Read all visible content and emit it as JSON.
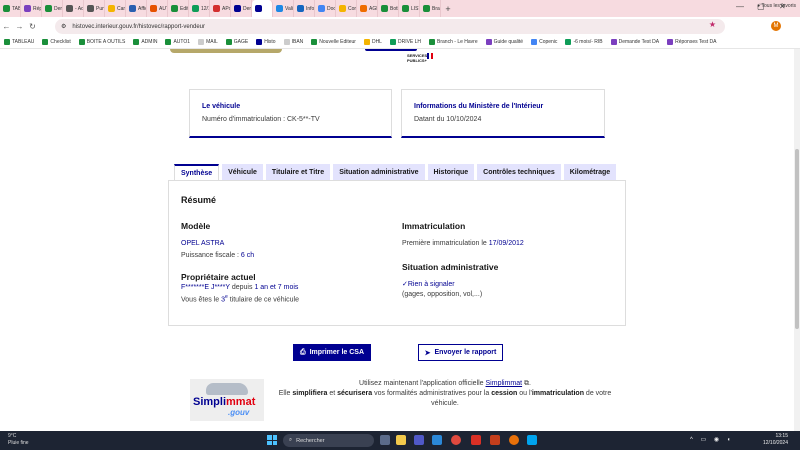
{
  "browser": {
    "tabs": [
      {
        "label": "TABL",
        "color": "#1a8f3a"
      },
      {
        "label": "Répc",
        "color": "#7b3fbf"
      },
      {
        "label": "Dem",
        "color": "#1a8f3a"
      },
      {
        "label": "- Ad",
        "color": "#555555"
      },
      {
        "label": "Puni",
        "color": "#555555"
      },
      {
        "label": "Car",
        "color": "#f4b400"
      },
      {
        "label": "Affic",
        "color": "#2a5fb0"
      },
      {
        "label": "AUT",
        "color": "#e65100"
      },
      {
        "label": "Editi",
        "color": "#1a8f3a"
      },
      {
        "label": "12/1",
        "color": "#0f9d58"
      },
      {
        "label": "APo",
        "color": "#d32f2f"
      },
      {
        "label": "Dem",
        "color": "#000091"
      },
      {
        "label": "",
        "color": "#000091",
        "active": true
      },
      {
        "label": "Vali",
        "color": "#1e88e5"
      },
      {
        "label": "Info",
        "color": "#1565c0"
      },
      {
        "label": "Doc",
        "color": "#4285f4"
      },
      {
        "label": "Con",
        "color": "#f4b400"
      },
      {
        "label": "AGE",
        "color": "#ef6c00"
      },
      {
        "label": "Both",
        "color": "#1a8f3a"
      },
      {
        "label": "LIST",
        "color": "#1a8f3a"
      },
      {
        "label": "Bran",
        "color": "#1a8f3a"
      }
    ],
    "url": "histovec.interieur.gouv.fr/histovec/rapport-vendeur",
    "profile_initial": "M",
    "bookmarks": [
      {
        "label": "TABLEAU",
        "color": "#1a8f3a"
      },
      {
        "label": "Checklist",
        "color": "#1a8f3a"
      },
      {
        "label": "BOITE A OUTILS",
        "color": "#1a8f3a"
      },
      {
        "label": "ADMIN",
        "color": "#1a8f3a"
      },
      {
        "label": "AUTO1",
        "color": "#1a8f3a"
      },
      {
        "label": "MAIL",
        "color": "#cccccc"
      },
      {
        "label": "GAGE",
        "color": "#1a8f3a"
      },
      {
        "label": "Histo",
        "color": "#000091"
      },
      {
        "label": "IBAN",
        "color": "#cccccc"
      },
      {
        "label": "Nouvelle Editeur",
        "color": "#1a8f3a"
      },
      {
        "label": "DHL",
        "color": "#f4b400"
      },
      {
        "label": "DRIVE LH",
        "color": "#0f9d58"
      },
      {
        "label": "Branch - Le Havre",
        "color": "#1a8f3a"
      },
      {
        "label": "Guide qualité",
        "color": "#7b3fbf"
      },
      {
        "label": "Copenic",
        "color": "#4285f4"
      },
      {
        "label": "-6 mois/- RIB",
        "color": "#0f9d58"
      },
      {
        "label": "Demande Test DA",
        "color": "#7b3fbf"
      },
      {
        "label": "Réponses Test DA",
        "color": "#7b3fbf"
      }
    ],
    "bookmarks_all": "Tous les favoris"
  },
  "header": {
    "service_public": "SERVICES PUBLICS+"
  },
  "cards": {
    "vehicle": {
      "title": "Le véhicule",
      "text": "Numéro d'immatriculation : CK-5**-TV"
    },
    "ministry": {
      "title": "Informations du Ministère de l'Intérieur",
      "text": "Datant du 10/10/2024"
    }
  },
  "tabs": [
    "Synthèse",
    "Véhicule",
    "Titulaire et Titre",
    "Situation administrative",
    "Historique",
    "Contrôles techniques",
    "Kilométrage"
  ],
  "synthese": {
    "title": "Résumé",
    "model_heading": "Modèle",
    "model_name": "OPEL ASTRA",
    "fiscal_label": "Puissance fiscale : ",
    "fiscal_value": "6 ch",
    "owner_heading": "Propriétaire actuel",
    "owner_name": "F*******E J****Y",
    "owner_since_label": " depuis ",
    "owner_since_value": "1 an et 7 mois",
    "owner_rank_prefix": "Vous êtes le ",
    "owner_rank_value": "3",
    "owner_rank_sup": "e",
    "owner_rank_suffix": " titulaire de ce véhicule",
    "immat_heading": "Immatriculation",
    "first_immat_label": "Première immatriculation le ",
    "first_immat_value": "17/09/2012",
    "admin_heading": "Situation administrative",
    "admin_status": "Rien à signaler",
    "admin_details": "(gages, opposition, vol,...)"
  },
  "actions": {
    "print": "Imprimer le CSA",
    "send": "Envoyer le rapport"
  },
  "promo": {
    "line1_prefix": "Utilisez maintenant l'application officielle ",
    "app_link": "Simplimmat",
    "line2_a": "Elle ",
    "line2_b": "simplifiera",
    "line2_c": " et ",
    "line2_d": "sécurisera",
    "line2_e": " vos formalités administratives pour la ",
    "line2_f": "cession",
    "line2_g": " ou l'",
    "line2_h": "immatriculation",
    "line2_i": " de votre véhicule.",
    "logo_word_a": "Simpli",
    "logo_word_b": "mmat",
    "logo_gouv": ".gouv"
  },
  "taskbar": {
    "temperature": "9°C",
    "weather": "Pluie fine",
    "search_placeholder": "Rechercher",
    "time": "13:15",
    "date": "12/10/2024"
  }
}
